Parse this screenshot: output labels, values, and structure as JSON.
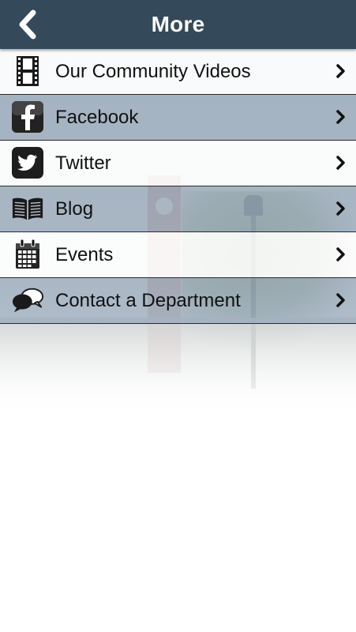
{
  "header": {
    "title": "More",
    "background": "#34495a"
  },
  "menu": {
    "items": [
      {
        "label": "Our Community Videos",
        "icon": "film-strip-icon"
      },
      {
        "label": "Facebook",
        "icon": "facebook-icon"
      },
      {
        "label": "Twitter",
        "icon": "twitter-icon"
      },
      {
        "label": "Blog",
        "icon": "open-book-icon"
      },
      {
        "label": "Events",
        "icon": "calendar-icon"
      },
      {
        "label": "Contact a Department",
        "icon": "speech-bubbles-icon"
      }
    ],
    "row_light_color": "#ffffff",
    "row_dark_color": "#94a5b8"
  }
}
